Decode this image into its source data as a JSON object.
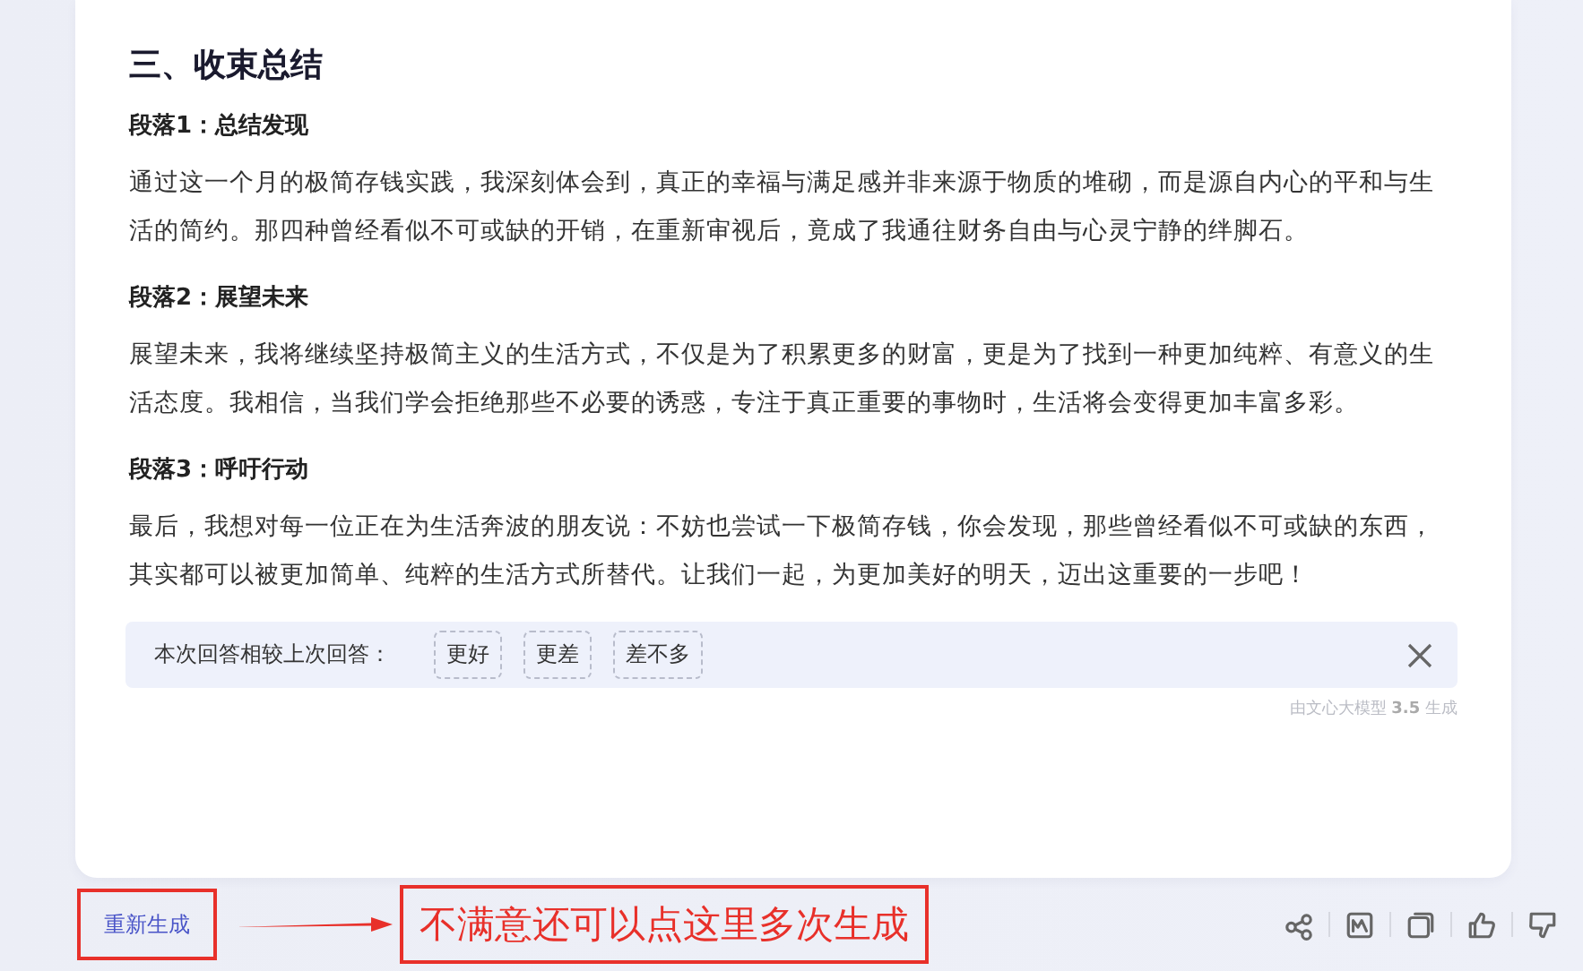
{
  "article": {
    "heading": "三、收束总结",
    "sections": [
      {
        "title": "段落1：总结发现",
        "text": "通过这一个月的极简存钱实践，我深刻体会到，真正的幸福与满足感并非来源于物质的堆砌，而是源自内心的平和与生活的简约。那四种曾经看似不可或缺的开销，在重新审视后，竟成了我通往财务自由与心灵宁静的绊脚石。"
      },
      {
        "title": "段落2：展望未来",
        "text": "展望未来，我将继续坚持极简主义的生活方式，不仅是为了积累更多的财富，更是为了找到一种更加纯粹、有意义的生活态度。我相信，当我们学会拒绝那些不必要的诱惑，专注于真正重要的事物时，生活将会变得更加丰富多彩。"
      },
      {
        "title": "段落3：呼吁行动",
        "text": "最后，我想对每一位正在为生活奔波的朋友说：不妨也尝试一下极简存钱，你会发现，那些曾经看似不可或缺的东西，其实都可以被更加简单、纯粹的生活方式所替代。让我们一起，为更加美好的明天，迈出这重要的一步吧！"
      }
    ]
  },
  "feedback": {
    "prompt": "本次回答相较上次回答：",
    "options": [
      "更好",
      "更差",
      "差不多"
    ]
  },
  "model_note": "由文心大模型 **3.5** 生成",
  "regenerate": "重新生成",
  "annotation": "不满意还可以点这里多次生成",
  "actions": [
    {
      "kind": "share"
    },
    {
      "kind": "image"
    },
    {
      "kind": "copy"
    },
    {
      "kind": "like"
    },
    {
      "kind": "dislike"
    }
  ]
}
